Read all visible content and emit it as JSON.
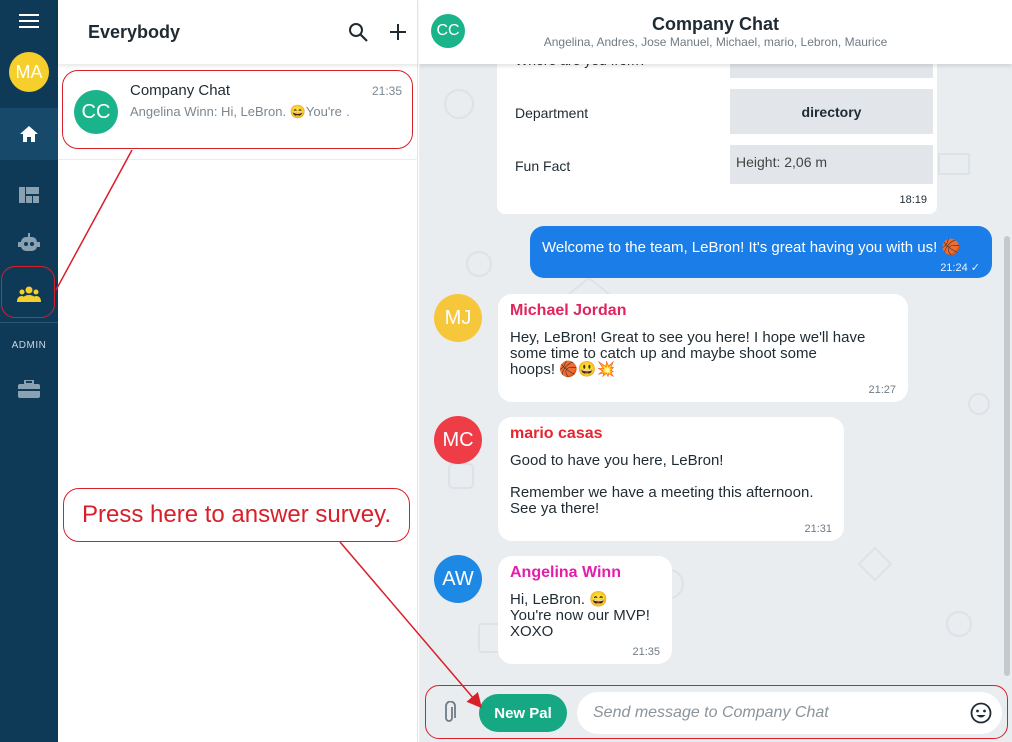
{
  "rail": {
    "user_initials": "MA",
    "admin_label": "ADMIN",
    "icons": [
      "menu-icon",
      "home-icon",
      "dashboard-icon",
      "robot-icon",
      "people-icon",
      "toolbox-icon"
    ]
  },
  "list": {
    "title": "Everybody",
    "conversation": {
      "initials": "CC",
      "name": "Company Chat",
      "time": "21:35",
      "preview": "Angelina Winn: Hi, LeBron. 😄You're …"
    }
  },
  "chat": {
    "initials": "CC",
    "title": "Company Chat",
    "members": "Angelina, Andres, Jose Manuel, Michael, mario, Lebron, Maurice"
  },
  "survey": {
    "partial_label": "Where are you from?",
    "rows": [
      {
        "label": "Department",
        "value": "directory"
      },
      {
        "label": "Fun Fact",
        "value": "Height: 2,06 m"
      }
    ],
    "time": "18:19"
  },
  "messages": {
    "outgoing": {
      "text": "Welcome to the team, LeBron! It's great having you with us! 🏀",
      "time": "21:24 ✓"
    },
    "michael": {
      "initials": "MJ",
      "sender": "Michael Jordan",
      "lines": [
        "Hey, LeBron! Great to see you here! I hope we'll have",
        "some time to catch up and maybe shoot some",
        "hoops! 🏀😃💥"
      ],
      "time": "21:27"
    },
    "mario": {
      "initials": "MC",
      "sender": "mario casas",
      "lines": [
        "Good to have you here, LeBron!",
        "Remember we have a meeting this afternoon.",
        "See ya there!"
      ],
      "time": "21:31"
    },
    "angelina": {
      "initials": "AW",
      "sender": "Angelina Winn",
      "lines": [
        "Hi, LeBron. 😄",
        "You're now our MVP!",
        "XOXO"
      ],
      "time": "21:35"
    }
  },
  "composer": {
    "new_pal": "New Pal",
    "placeholder": "Send message to Company Chat"
  },
  "annotation": {
    "callout": "Press here to answer survey."
  },
  "colors": {
    "rail": "#0e3a57",
    "accent_green": "#15a883",
    "outgoing_blue": "#1a7de8",
    "annotation_red": "#d8202a",
    "michael_avatar": "#f6c73a",
    "mario_avatar": "#ef3d48",
    "angelina_avatar": "#1e88e5"
  }
}
